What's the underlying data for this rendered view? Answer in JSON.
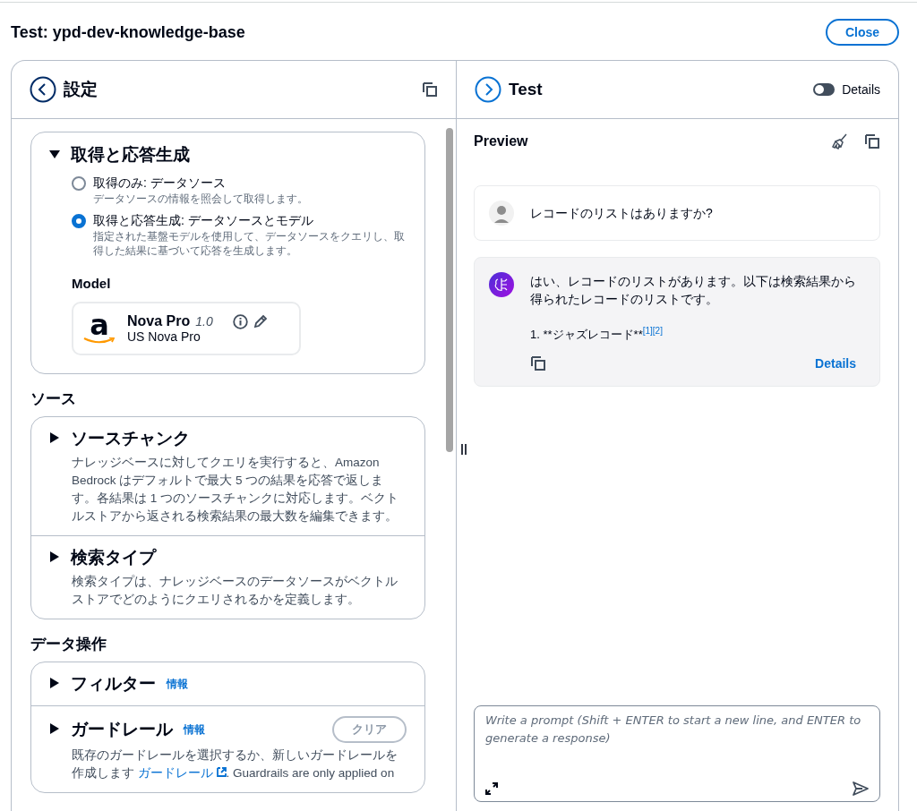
{
  "title": "Test: ypd-dev-knowledge-base",
  "close_button": "Close",
  "settings_panel": {
    "title": "設定",
    "generation_section": {
      "title": "取得と応答生成",
      "expanded": true,
      "options": [
        {
          "label": "取得のみ: データソース",
          "description": "データソースの情報を照会して取得します。",
          "selected": false
        },
        {
          "label": "取得と応答生成: データソースとモデル",
          "description": "指定された基盤モデルを使用して、データソースをクエリし、取得した結果に基づいて応答を生成します。",
          "selected": true
        }
      ],
      "model_label": "Model",
      "model": {
        "logo": "a",
        "name": "Nova Pro",
        "version": "1.0",
        "provider": "US Nova Pro"
      }
    },
    "groups": [
      {
        "heading": "ソース",
        "sections": [
          {
            "title": "ソースチャンク",
            "expanded": false,
            "description": "ナレッジベースに対してクエリを実行すると、Amazon Bedrock はデフォルトで最大 5 つの結果を応答で返します。各結果は 1 つのソースチャンクに対応します。ベクトルストアから返される検索結果の最大数を編集できます。"
          },
          {
            "title": "検索タイプ",
            "expanded": false,
            "description": "検索タイプは、ナレッジベースのデータソースがベクトルストアでどのようにクエリされるかを定義します。"
          }
        ]
      },
      {
        "heading": "データ操作",
        "sections": [
          {
            "title": "フィルター",
            "expanded": false,
            "info": "情報"
          },
          {
            "title": "ガードレール",
            "expanded": false,
            "info": "情報",
            "clear_button": "クリア",
            "description": "既存のガードレールを選択するか、新しいガードレールを作成します",
            "link": "ガードレール",
            "description_after": ". Guardrails are only applied on"
          }
        ]
      }
    ]
  },
  "test_panel": {
    "title": "Test",
    "details_toggle": {
      "label": "Details",
      "on": false
    },
    "preview_title": "Preview",
    "messages": [
      {
        "kind": "user",
        "text": "レコードのリストはありますか?"
      },
      {
        "kind": "assistant",
        "text": "はい、レコードのリストがあります。以下は検索結果から得られたレコードのリストです。",
        "list_item": "1. **ジャズレコード**",
        "citations": [
          "[1]",
          "[2]"
        ],
        "details_link": "Details"
      }
    ],
    "prompt": {
      "placeholder": "Write a prompt (Shift + ENTER to start a new line, and ENTER to generate a response)"
    }
  }
}
